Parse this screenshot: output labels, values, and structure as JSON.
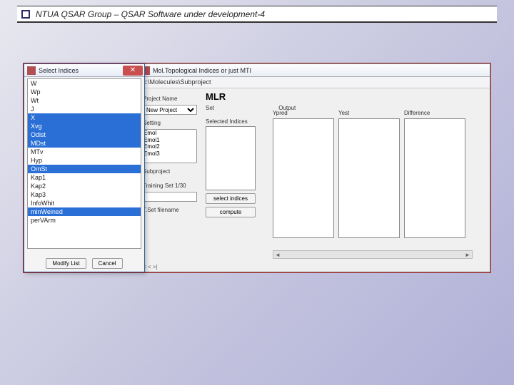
{
  "slide": {
    "title": "NTUA QSAR Group –  QSAR Software under development-4"
  },
  "mainWindow": {
    "title": "Mol.Topological Indices or just MTI",
    "subtitle": "c:\\Molecules\\Subproject",
    "labels": {
      "projectName": "Project Name",
      "setting": "Setting",
      "subproject": "Subproject",
      "trainingSet": "Training Set   1/30",
      "testSetFile": "T.Set filename"
    },
    "newProjectOption": "New Project",
    "settingOptions": [
      "Emol",
      "Emol1",
      "Emol2",
      "Emol3"
    ],
    "mlr": "MLR",
    "setCol": "Set",
    "output": "Output",
    "selectedIndices": "Selected Indices",
    "btnSelectIndices": "select indices",
    "btnCompute": "compute",
    "col1": "Ypred",
    "col2": "Yest",
    "col3": "Difference",
    "status": "|< < >|"
  },
  "dialog": {
    "title": "Select Indices",
    "items": [
      {
        "t": "W",
        "sel": false
      },
      {
        "t": "Wp",
        "sel": false
      },
      {
        "t": "Wt",
        "sel": false
      },
      {
        "t": "J",
        "sel": false
      },
      {
        "t": "X",
        "sel": true
      },
      {
        "t": "Xvg",
        "sel": true,
        "red": true
      },
      {
        "t": "Odist",
        "sel": true,
        "red": true
      },
      {
        "t": "MDst",
        "sel": true
      },
      {
        "t": "MTv",
        "sel": false
      },
      {
        "t": "Hyp",
        "sel": false
      },
      {
        "t": "OmSt",
        "sel": true,
        "red": true
      },
      {
        "t": "Kap1",
        "sel": false
      },
      {
        "t": "Kap2",
        "sel": false
      },
      {
        "t": "Kap3",
        "sel": false
      },
      {
        "t": "InfoWhit",
        "sel": false
      },
      {
        "t": "minWeined",
        "sel": true
      },
      {
        "t": "perVArm",
        "sel": false
      }
    ],
    "btnModify": "Modify List",
    "btnCancel": "Cancel"
  }
}
